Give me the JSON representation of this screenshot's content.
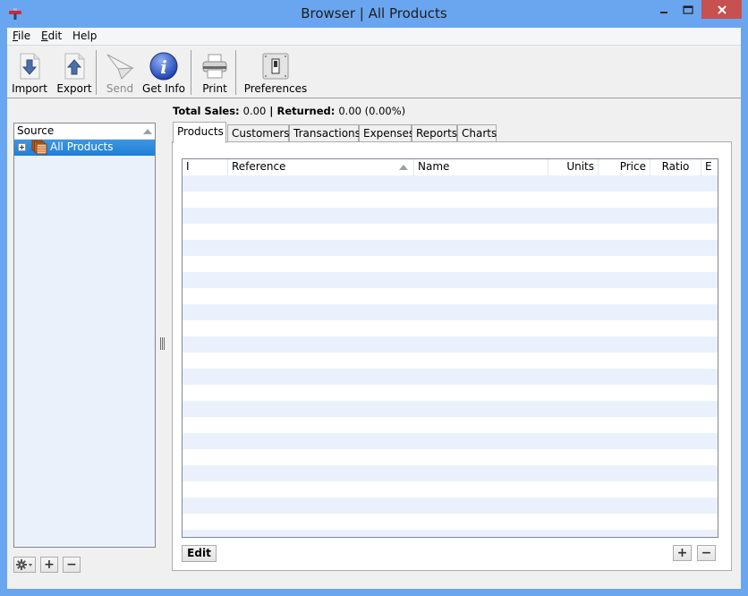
{
  "window": {
    "title": "Browser | All Products",
    "controls": {
      "minimize": "minimize",
      "maximize": "maximize",
      "close": "close"
    }
  },
  "menu": [
    {
      "label": "File",
      "mnemonic": "F",
      "rest": "ile"
    },
    {
      "label": "Edit",
      "mnemonic": "E",
      "rest": "dit"
    },
    {
      "label": "Help",
      "mnemonic": "",
      "rest": "Help"
    }
  ],
  "toolbar": {
    "import": {
      "label": "Import",
      "icon": "import-arrow-down-icon",
      "enabled": true
    },
    "export": {
      "label": "Export",
      "icon": "export-arrow-up-icon",
      "enabled": true
    },
    "send": {
      "label": "Send",
      "icon": "paper-plane-icon",
      "enabled": false
    },
    "get_info": {
      "label": "Get Info",
      "icon": "info-icon",
      "enabled": true
    },
    "print": {
      "label": "Print",
      "icon": "printer-icon",
      "enabled": true
    },
    "preferences": {
      "label": "Preferences",
      "icon": "switch-icon",
      "enabled": true
    }
  },
  "source": {
    "header": "Source",
    "items": [
      {
        "label": "All Products",
        "selected": true,
        "expandable": true
      }
    ],
    "buttons": {
      "actions": "gear-menu",
      "add": "+",
      "remove": "−"
    }
  },
  "totals": {
    "sales_label": "Total Sales:",
    "sales_value": "0.00",
    "separator": "|",
    "returned_label": "Returned:",
    "returned_value": "0.00 (0.00%)"
  },
  "tabs": [
    {
      "label": "Products",
      "active": true
    },
    {
      "label": "Customers",
      "active": false
    },
    {
      "label": "Transactions",
      "active": false
    },
    {
      "label": "Expenses",
      "active": false
    },
    {
      "label": "Reports",
      "active": false
    },
    {
      "label": "Charts",
      "active": false
    }
  ],
  "products_table": {
    "columns": [
      {
        "label": "I",
        "align": "left"
      },
      {
        "label": "Reference",
        "align": "left",
        "sorted": "ascending"
      },
      {
        "label": "Name",
        "align": "left"
      },
      {
        "label": "Units",
        "align": "right"
      },
      {
        "label": "Price",
        "align": "right"
      },
      {
        "label": "Ratio",
        "align": "right"
      },
      {
        "label": "E",
        "align": "left"
      }
    ],
    "rows": []
  },
  "table_buttons": {
    "edit": "Edit",
    "add": "+",
    "remove": "−"
  },
  "colors": {
    "titlebar": "#6aa6f0",
    "close": "#c75050",
    "selection": "#1e80d8",
    "row_alt": "#eaf1fc"
  }
}
